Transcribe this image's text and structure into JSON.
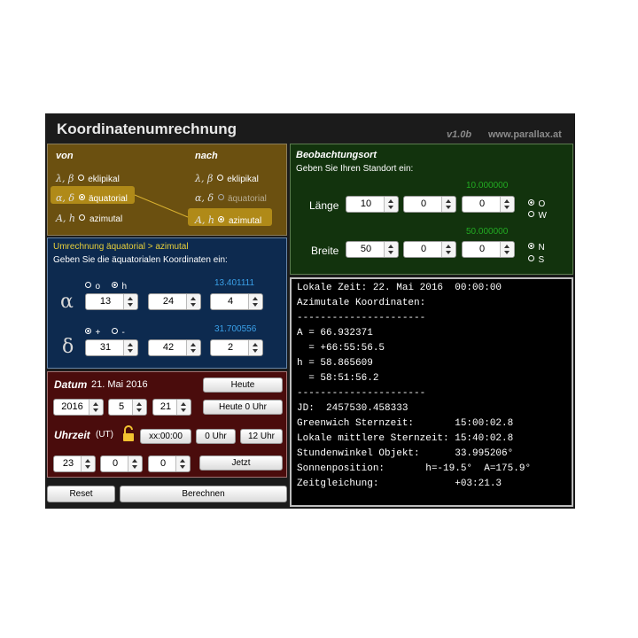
{
  "header": {
    "title": "Koordinatenumrechnung",
    "version": "v1.0b",
    "site": "www.parallax.at"
  },
  "von_nach": {
    "von_label": "von",
    "nach_label": "nach",
    "rows": [
      {
        "symbol": "λ, β",
        "label": "eklipikal"
      },
      {
        "symbol": "α, δ",
        "label": "äquatorial"
      },
      {
        "symbol": "A, h",
        "label": "azimutal"
      }
    ],
    "von_selected": "äquatorial",
    "nach_selected": "azimutal"
  },
  "beobachtungsort": {
    "title": "Beobachtungsort",
    "subtitle": "Geben Sie Ihren Standort ein:",
    "laenge": {
      "label": "Länge",
      "decimal": "10.000000",
      "deg": "10",
      "min": "0",
      "sec": "0",
      "opt1": "O",
      "opt2": "W"
    },
    "breite": {
      "label": "Breite",
      "decimal": "50.000000",
      "deg": "50",
      "min": "0",
      "sec": "0",
      "opt1": "N",
      "opt2": "S"
    }
  },
  "umrechnung": {
    "title": "Umrechnung äquatorial > azimutal",
    "subtitle": "Geben Sie die äquatorialen Koordinaten ein:",
    "alpha": {
      "symbol": "α",
      "unit1": "o",
      "unit2": "h",
      "decimal": "13.401111",
      "v1": "13",
      "v2": "24",
      "v3": "4"
    },
    "delta": {
      "symbol": "δ",
      "sign1": "+",
      "sign2": "-",
      "decimal": "31.700556",
      "v1": "31",
      "v2": "42",
      "v3": "2"
    }
  },
  "datum": {
    "label": "Datum",
    "date_text": "21. Mai 2016",
    "year": "2016",
    "month": "5",
    "day": "21",
    "btn_heute": "Heute",
    "btn_heute0": "Heute 0 Uhr"
  },
  "uhrzeit": {
    "label": "Uhrzeit",
    "ut": "(UT)",
    "btn_xx": "xx:00:00",
    "btn_0": "0 Uhr",
    "btn_12": "12 Uhr",
    "h": "23",
    "m": "0",
    "s": "0",
    "btn_jetzt": "Jetzt"
  },
  "footer": {
    "reset": "Reset",
    "berechnen": "Berechnen"
  },
  "output": {
    "lines": [
      "Lokale Zeit: 22. Mai 2016  00:00:00",
      "Azimutale Koordinaten:",
      "----------------------",
      "A = 66.932371",
      "  = +66:55:56.5",
      "h = 58.865609",
      "  = 58:51:56.2",
      "----------------------",
      "JD:  2457530.458333",
      "Greenwich Sternzeit:       15:00:02.8",
      "Lokale mittlere Sternzeit: 15:40:02.8",
      "Stundenwinkel Objekt:      33.995206°",
      "Sonnenposition:       h=-19.5°  A=175.9°",
      "Zeitgleichung:             +03:21.3"
    ]
  }
}
